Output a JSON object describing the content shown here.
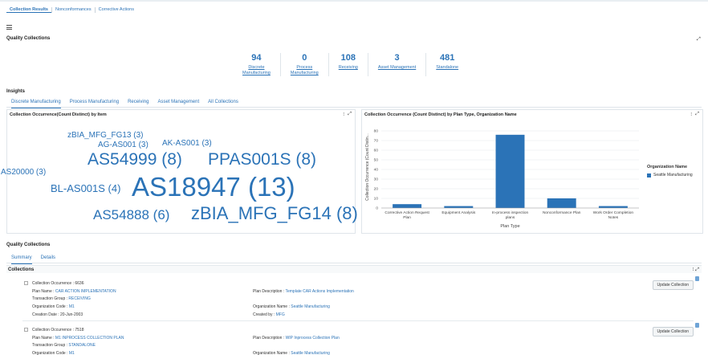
{
  "top_tabs": [
    "Collection Results",
    "Nonconformances",
    "Corrective Actions"
  ],
  "quality_collections": {
    "title": "Quality Collections",
    "stats": [
      {
        "value": "94",
        "line1": "Discrete",
        "line2": "Manufacturing"
      },
      {
        "value": "0",
        "line1": "Process",
        "line2": "Manufacturing"
      },
      {
        "value": "108",
        "line1": "Receiving",
        "line2": ""
      },
      {
        "value": "3",
        "line1": "Asset Management",
        "line2": ""
      },
      {
        "value": "481",
        "line1": "Standalone",
        "line2": ""
      }
    ]
  },
  "insights": {
    "title": "Insights",
    "tabs": [
      "Discrete Manufacturing",
      "Process Manufacturing",
      "Receiving",
      "Asset Management",
      "All Collections"
    ]
  },
  "word_cloud": {
    "title": "Collection Occurrence(Count Distinct) by Item",
    "words": [
      {
        "text": "zBIA_MFG_FG13 (3)"
      },
      {
        "text": "AG-AS001 (3)"
      },
      {
        "text": "AK-AS001 (3)"
      },
      {
        "text": "AS54999 (8)"
      },
      {
        "text": "PPAS001S (8)"
      },
      {
        "text": "AS20000 (3)"
      },
      {
        "text": "BL-AS001S (4)"
      },
      {
        "text": "AS18947 (13)"
      },
      {
        "text": "AS54888 (6)"
      },
      {
        "text": "zBIA_MFG_FG14 (8)"
      }
    ]
  },
  "chart_panel": {
    "title": "Collection Occurrence (Count Distinct) by Plan Type, Organization Name",
    "legend_title": "Organization Name"
  },
  "chart_data": {
    "type": "bar",
    "categories": [
      [
        "Corrective Action Request",
        "Plan"
      ],
      [
        "Equipment Analysis"
      ],
      [
        "In-process inspection",
        "plans"
      ],
      [
        "Nonconformance Plan"
      ],
      [
        "Work Order Completion",
        "Notes"
      ]
    ],
    "series": [
      {
        "name": "Seattle Manufacturing",
        "values": [
          4,
          2,
          76,
          10,
          2
        ]
      }
    ],
    "xlabel": "Plan Type",
    "ylabel": "Collection Occurrence (Count Distin...",
    "ylim": [
      0,
      85
    ],
    "yticks": [
      0,
      10,
      20,
      30,
      40,
      50,
      60,
      70,
      80
    ],
    "grid": true,
    "legend_position": "right",
    "bar_color": "#2b73b7"
  },
  "quality_collections_2": {
    "title": "Quality Collections",
    "tabs": [
      "Summary",
      "Details"
    ],
    "collections_label": "Collections"
  },
  "cards": [
    {
      "occurrence": "Collection Occurrence : 6636",
      "plan_name_label": "Plan Name : ",
      "plan_name": "CAR ACTION IMPLEMENTATION",
      "plan_desc_label": "Plan Description : ",
      "plan_desc": "Template CAR Actions Implementation",
      "txn_group_label": "Transaction Group : ",
      "txn_group": "RECEIVING",
      "org_code_label": "Organization Code : ",
      "org_code": "M1",
      "org_name_label": "Organization Name : ",
      "org_name": "Seattle Manufacturing",
      "creation_date": "Creation Date : 20-Jun-2003",
      "created_by_label": "Created by : ",
      "created_by": "MFG",
      "button": "Update Collection"
    },
    {
      "occurrence": "Collection Occurrence : 7518",
      "plan_name_label": "Plan Name : ",
      "plan_name": "M1 INPROCESS COLLECTION PLAN",
      "plan_desc_label": "Plan Description : ",
      "plan_desc": "WIP Inprocess Collection Plan",
      "txn_group_label": "Transaction Group : ",
      "txn_group": "STANDALONE",
      "org_code_label": "Organization Code : ",
      "org_code": "M1",
      "org_name_label": "Organization Name : ",
      "org_name": "Seattle Manufacturing",
      "button": "Update Collection"
    }
  ]
}
